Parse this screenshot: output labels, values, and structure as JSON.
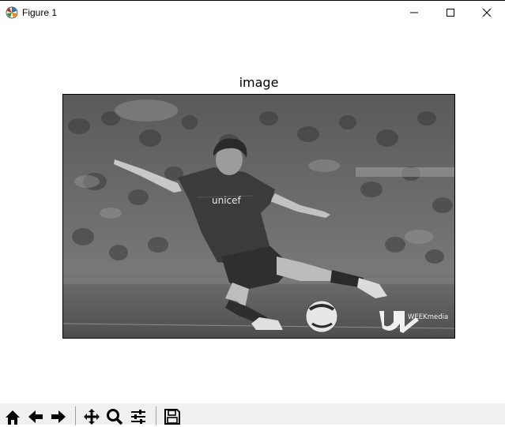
{
  "window": {
    "title": "Figure 1",
    "controls": [
      "minimize",
      "maximize",
      "close"
    ]
  },
  "figure": {
    "axes_title": "image",
    "image_watermark": "WEEKmedia",
    "image_shirt_text": "unicef"
  },
  "toolbar": {
    "buttons": [
      "home-icon",
      "back-icon",
      "forward-icon",
      "pan-icon",
      "zoom-icon",
      "configure-subplots-icon",
      "save-icon"
    ]
  }
}
